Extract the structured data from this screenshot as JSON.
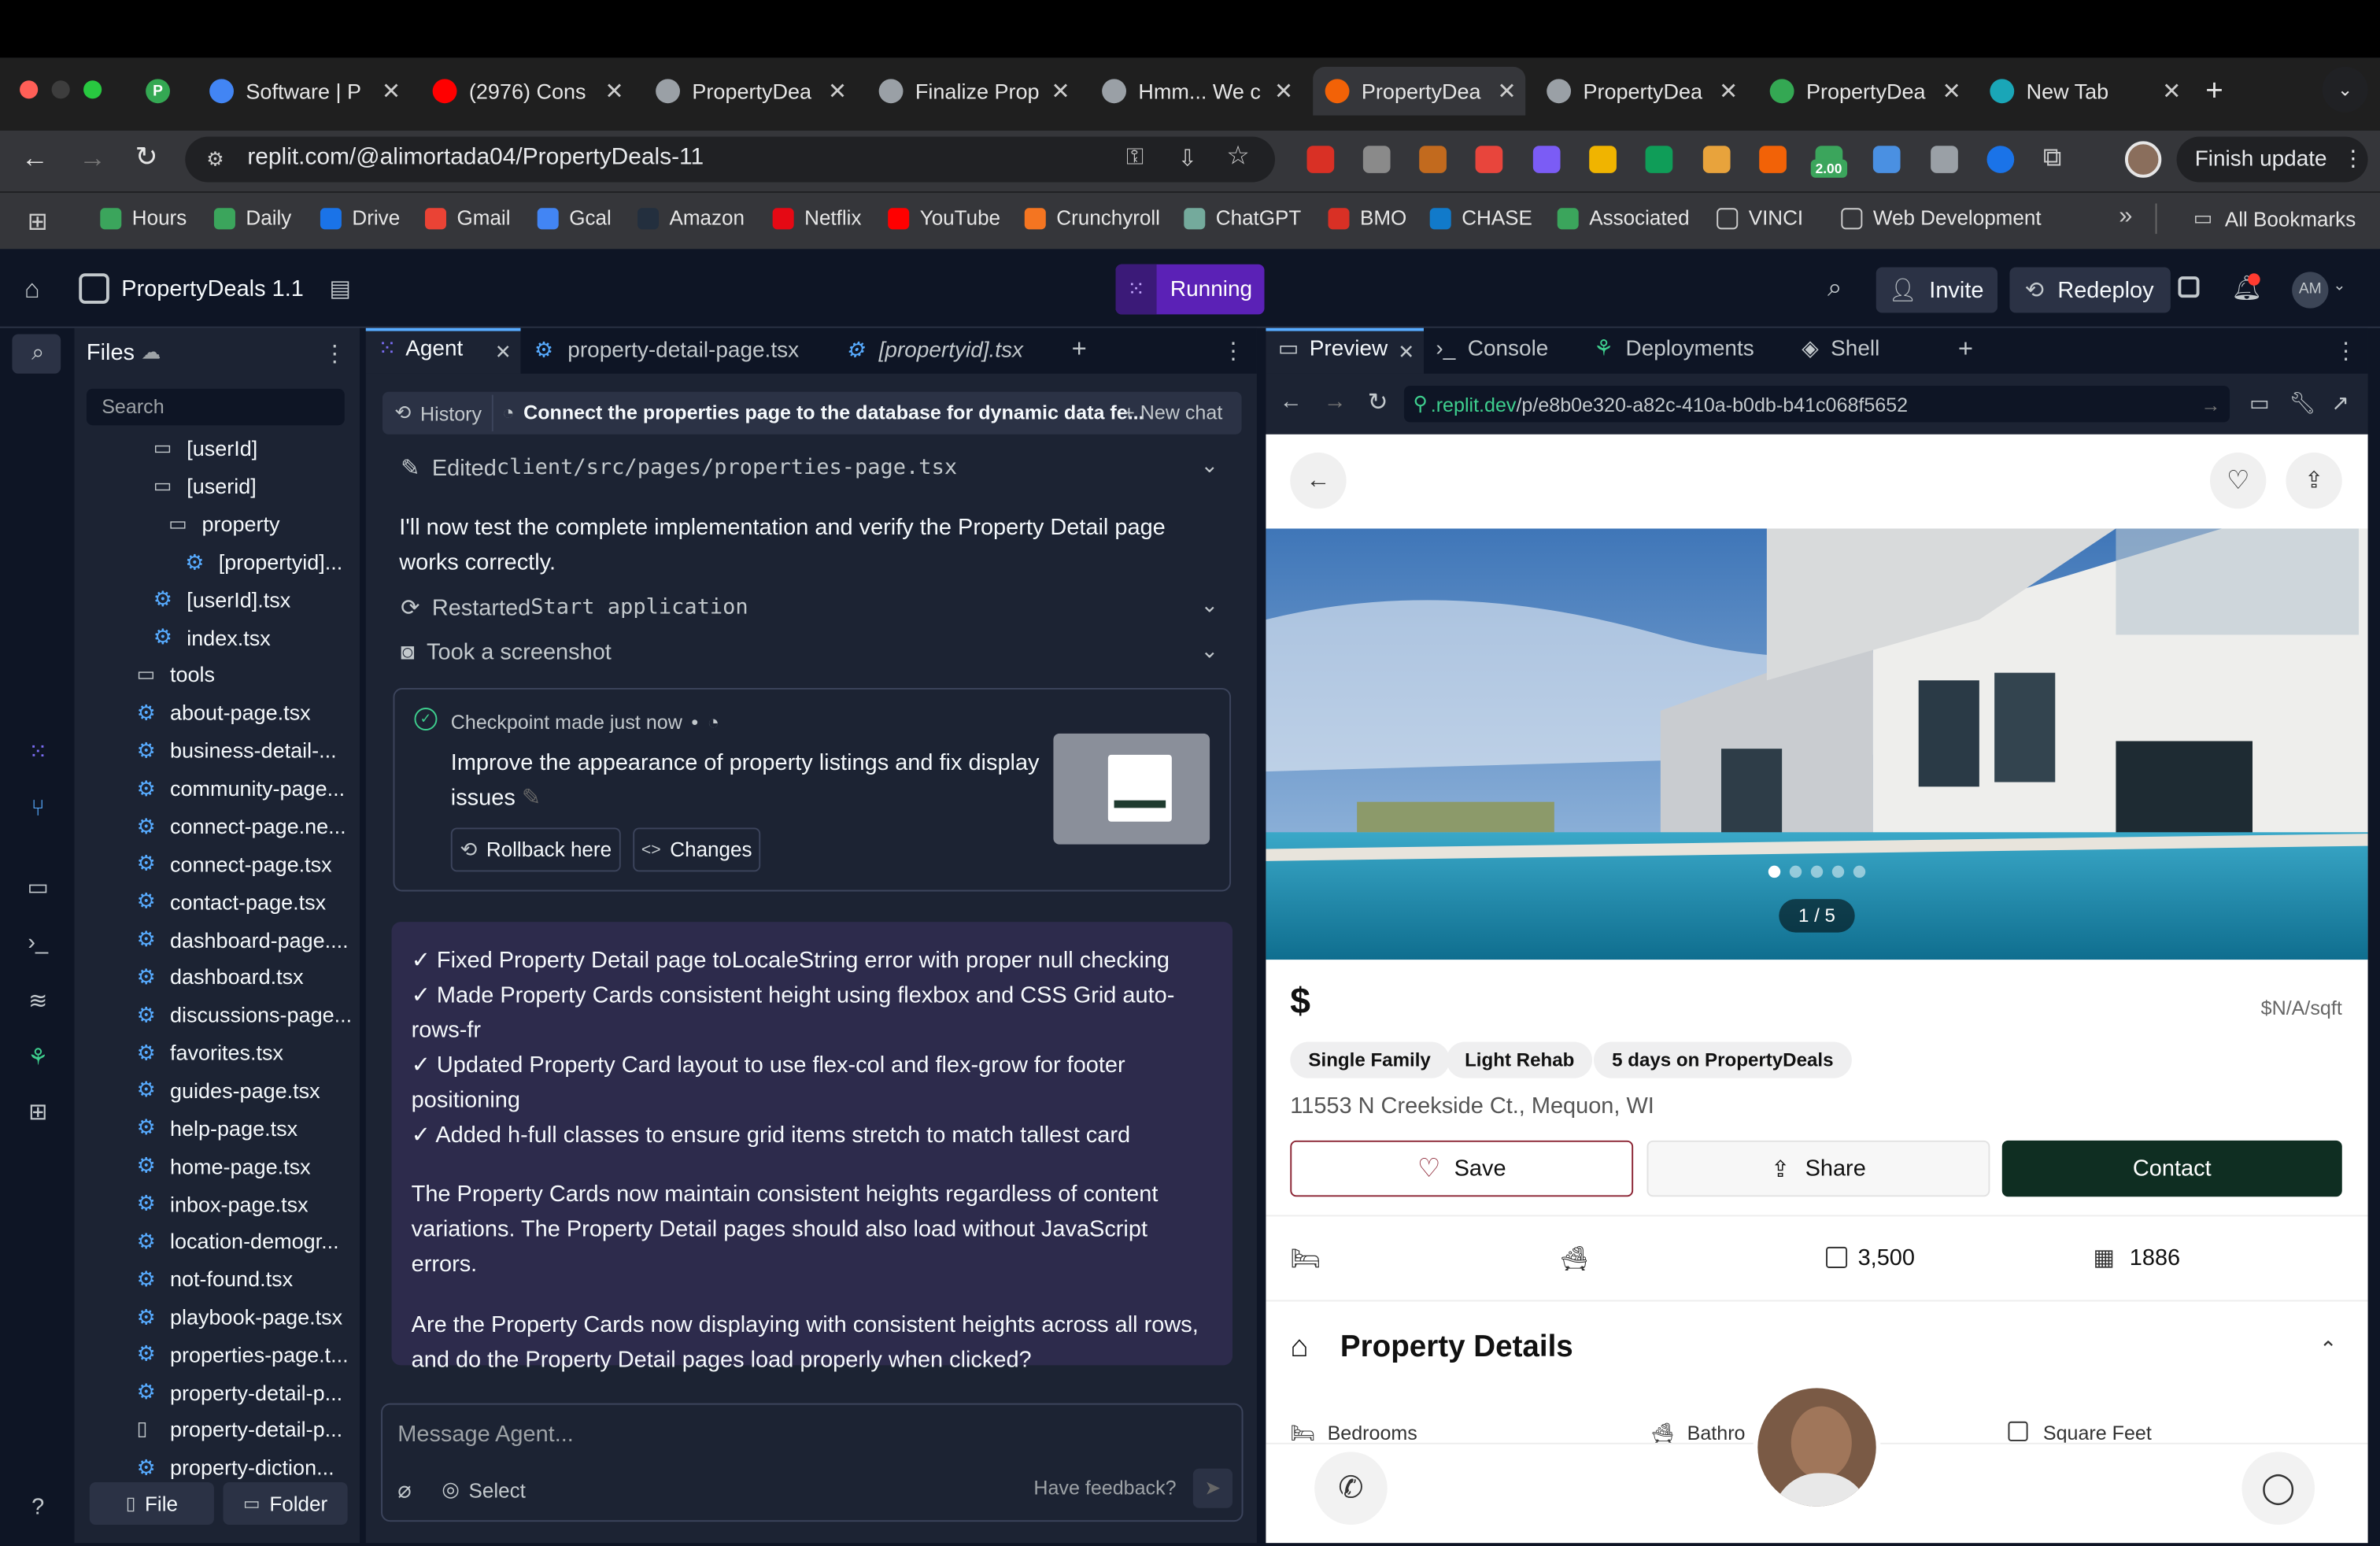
{
  "browser": {
    "tabs": [
      {
        "title": "P",
        "color": "#34a853"
      },
      {
        "title": "Software | P",
        "color": "#4285f4"
      },
      {
        "title": "(2976) Cons",
        "color": "#ff0000"
      },
      {
        "title": "PropertyDea",
        "color": "#9aa0a6"
      },
      {
        "title": "Finalize Prop",
        "color": "#9aa0a6"
      },
      {
        "title": "Hmm... We c",
        "color": "#9aa0a6"
      },
      {
        "title": "PropertyDea",
        "color": "#f26207"
      },
      {
        "title": "PropertyDea",
        "color": "#9aa0a6"
      },
      {
        "title": "PropertyDea",
        "color": "#34a853"
      },
      {
        "title": "New Tab",
        "color": "#1aa6b7"
      }
    ],
    "url": "replit.com/@alimortada04/PropertyDeals-11",
    "ext_badge": "2.00",
    "finish_update": "Finish update",
    "bookmarks": [
      "Hours",
      "Daily",
      "Drive",
      "Gmail",
      "Gcal",
      "Amazon",
      "Netflix",
      "YouTube",
      "Crunchyroll",
      "ChatGPT",
      "BMO",
      "CHASE",
      "Associated",
      "VINCI",
      "Web Development"
    ],
    "all_bookmarks": "All Bookmarks"
  },
  "header": {
    "project": "PropertyDeals 1.1",
    "status": "Running",
    "invite": "Invite",
    "redeploy": "Redeploy",
    "avatar": "AM"
  },
  "files": {
    "title": "Files",
    "search_placeholder": "Search",
    "items": [
      {
        "name": "[userId]",
        "type": "folder",
        "indent": 2
      },
      {
        "name": "[userid]",
        "type": "folder",
        "indent": 2
      },
      {
        "name": "property",
        "type": "folder",
        "indent": 3
      },
      {
        "name": "[propertyid]...",
        "type": "file",
        "indent": 4
      },
      {
        "name": "[userId].tsx",
        "type": "file",
        "indent": 2
      },
      {
        "name": "index.tsx",
        "type": "file",
        "indent": 2
      },
      {
        "name": "tools",
        "type": "folder",
        "indent": 1
      },
      {
        "name": "about-page.tsx",
        "type": "file",
        "indent": 1
      },
      {
        "name": "business-detail-...",
        "type": "file",
        "indent": 1
      },
      {
        "name": "community-page...",
        "type": "file",
        "indent": 1
      },
      {
        "name": "connect-page.ne...",
        "type": "file",
        "indent": 1
      },
      {
        "name": "connect-page.tsx",
        "type": "file",
        "indent": 1
      },
      {
        "name": "contact-page.tsx",
        "type": "file",
        "indent": 1
      },
      {
        "name": "dashboard-page....",
        "type": "file",
        "indent": 1
      },
      {
        "name": "dashboard.tsx",
        "type": "file",
        "indent": 1
      },
      {
        "name": "discussions-page...",
        "type": "file",
        "indent": 1
      },
      {
        "name": "favorites.tsx",
        "type": "file",
        "indent": 1
      },
      {
        "name": "guides-page.tsx",
        "type": "file",
        "indent": 1
      },
      {
        "name": "help-page.tsx",
        "type": "file",
        "indent": 1
      },
      {
        "name": "home-page.tsx",
        "type": "file",
        "indent": 1
      },
      {
        "name": "inbox-page.tsx",
        "type": "file",
        "indent": 1
      },
      {
        "name": "location-demogr...",
        "type": "file",
        "indent": 1
      },
      {
        "name": "not-found.tsx",
        "type": "file",
        "indent": 1
      },
      {
        "name": "playbook-page.tsx",
        "type": "file",
        "indent": 1
      },
      {
        "name": "properties-page.t...",
        "type": "file",
        "indent": 1
      },
      {
        "name": "property-detail-p...",
        "type": "file",
        "indent": 1
      },
      {
        "name": "property-detail-p...",
        "type": "doc",
        "indent": 1
      },
      {
        "name": "property-diction...",
        "type": "file",
        "indent": 1
      }
    ],
    "file_btn": "File",
    "folder_btn": "Folder"
  },
  "agent": {
    "tabs": [
      "Agent",
      "property-detail-page.tsx",
      "[propertyid].tsx"
    ],
    "history": "History",
    "chat_title": "Connect the properties page to the database for dynamic data fe...",
    "new_chat": "New chat",
    "edited_prefix": "Edited ",
    "edited_file": "client/src/pages/properties-page.tsx",
    "msg1": "I'll now test the complete implementation and verify the Property Detail page works correctly.",
    "restarted_prefix": "Restarted ",
    "restarted_target": "Start application",
    "screenshot": "Took a screenshot",
    "checkpoint_label": "Checkpoint made just now",
    "checkpoint_text": "Improve the appearance of property listings and fix display issues",
    "rollback": "Rollback here",
    "changes": "Changes",
    "bullets": [
      "✓ Fixed Property Detail page toLocaleString error with proper null checking",
      "✓ Made Property Cards consistent height using flexbox and CSS Grid auto-rows-fr",
      "✓ Updated Property Card layout to use flex-col and flex-grow for footer positioning",
      "✓ Added h-full classes to ensure grid items stretch to match tallest card"
    ],
    "para1": "The Property Cards now maintain consistent heights regardless of content variations. The Property Detail pages should also load without JavaScript errors.",
    "para2": "Are the Property Cards now displaying with consistent heights across all rows, and do the Property Detail pages load properly when clicked?",
    "input_placeholder": "Message Agent...",
    "select": "Select",
    "feedback": "Have feedback?"
  },
  "preview": {
    "tabs": [
      "Preview",
      "Console",
      "Deployments",
      "Shell"
    ],
    "url_prefix": ".replit.dev",
    "url_path": "/p/e8b0e320-a82c-410a-b0db-b41c068f5652",
    "image_counter": "1 / 5",
    "image_count": 5,
    "price": "$",
    "per_sqft": "$N/A/sqft",
    "tags": [
      "Single Family",
      "Light Rehab",
      "5 days on PropertyDeals"
    ],
    "address": "11553 N Creekside Ct., Mequon, WI",
    "save": "Save",
    "share": "Share",
    "contact": "Contact",
    "sqft": "3,500",
    "year": "1886",
    "details_title": "Property Details",
    "detail_labels": [
      "Bedrooms",
      "Bathro",
      "Square Feet"
    ]
  },
  "colors": {
    "accent": "#7c3aed",
    "gear": "#57abff",
    "contact_bg": "#0f2e22",
    "save_border": "#8b2433"
  }
}
